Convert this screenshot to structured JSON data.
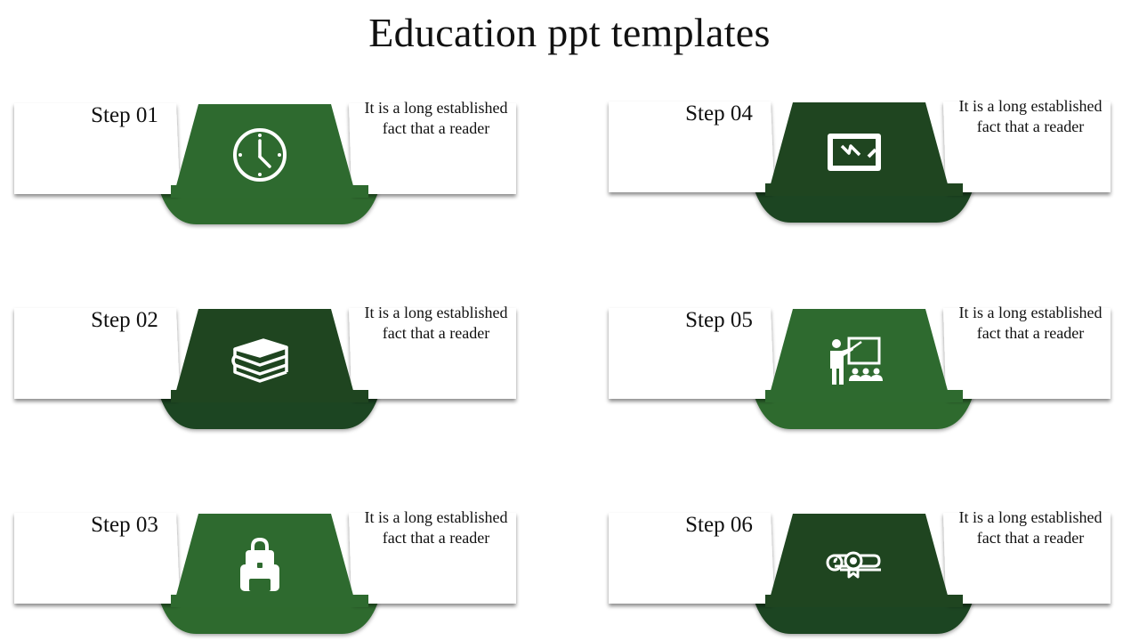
{
  "title": "Education ppt templates",
  "colors": {
    "green_light": "#2e6a2f",
    "green_dark": "#1f4520",
    "icon": "#ffffff"
  },
  "steps": [
    {
      "label": "Step 01",
      "text_line1": "It is a long established",
      "text_line2": "fact that a reader",
      "icon": "clock-icon",
      "tone": "light"
    },
    {
      "label": "Step 02",
      "text_line1": "It is a long established",
      "text_line2": "fact that a reader",
      "icon": "books-icon",
      "tone": "dark"
    },
    {
      "label": "Step 03",
      "text_line1": "It is a long established",
      "text_line2": "fact that a reader",
      "icon": "backpack-icon",
      "tone": "light"
    },
    {
      "label": "Step 04",
      "text_line1": "It is a long established",
      "text_line2": "fact that a reader",
      "icon": "chalkboard-icon",
      "tone": "dark"
    },
    {
      "label": "Step 05",
      "text_line1": "It is a long established",
      "text_line2": "fact that a reader",
      "icon": "teacher-icon",
      "tone": "light"
    },
    {
      "label": "Step 06",
      "text_line1": "It is a long established",
      "text_line2": "fact that a reader",
      "icon": "diploma-icon",
      "tone": "dark"
    }
  ]
}
